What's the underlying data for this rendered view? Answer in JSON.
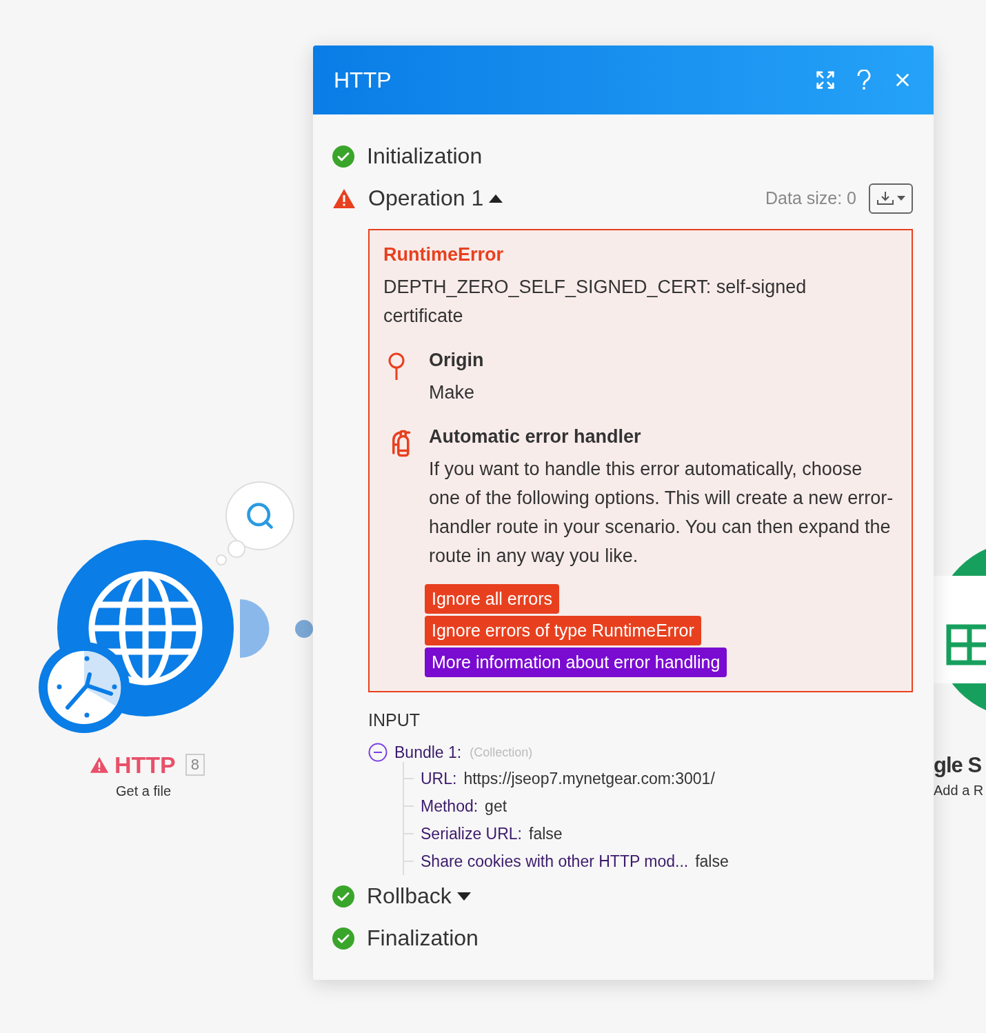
{
  "canvas": {
    "modules": [
      {
        "kind": "http",
        "name": "HTTP",
        "count": "8",
        "subtitle": "Get a file",
        "warning": true
      },
      {
        "kind": "sheets",
        "name": "gle S",
        "subtitle": "Add a R",
        "warning": false
      }
    ]
  },
  "dialog": {
    "title": "HTTP",
    "stages": [
      {
        "label": "Initialization",
        "failed": false
      },
      {
        "label": "Operation 1",
        "failed": true,
        "expanded": true,
        "data_size": "Data size: 0",
        "error": {
          "type": "RuntimeError",
          "message": "DEPTH_ZERO_SELF_SIGNED_CERT: self-signed certificate",
          "sections": [
            {
              "kind": "origin",
              "title": "Origin",
              "text": "Make"
            },
            {
              "kind": "handler",
              "title": "Automatic error handler",
              "text": "If you want to handle this error automatically, choose one of the following options. This will create a new error-handler route in your scenario. You can then expand the route in any way you like."
            }
          ],
          "actions": [
            {
              "label": "Ignore all errors",
              "color": "#e8401f"
            },
            {
              "label": "Ignore errors of type RuntimeError",
              "color": "#e8401f"
            },
            {
              "label": "More information about error handling",
              "color": "#7a0bd1"
            }
          ]
        },
        "input": {
          "heading": "INPUT",
          "bundle": {
            "label": "Bundle 1:",
            "type": "(Collection)",
            "expanded": true,
            "fields": [
              {
                "key": "URL:",
                "value": "https://jseop7.mynetgear.com:3001/"
              },
              {
                "key": "Method:",
                "value": "get"
              },
              {
                "key": "Serialize URL:",
                "value": "false"
              },
              {
                "key": "Share cookies with other HTTP mod...",
                "value": "false"
              }
            ]
          }
        }
      },
      {
        "label": "Rollback",
        "failed": false,
        "expanded": false
      },
      {
        "label": "Finalization",
        "failed": false
      }
    ]
  }
}
